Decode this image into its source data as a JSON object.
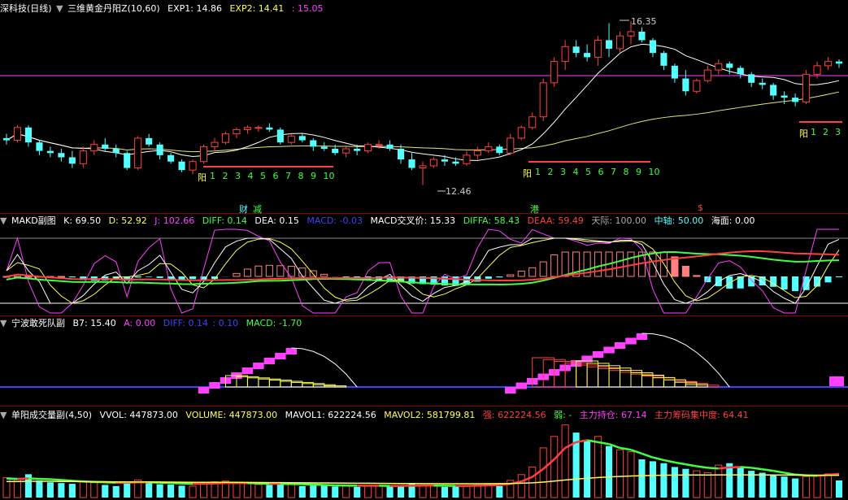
{
  "colors": {
    "red": "#ff4040",
    "cyan": "#54ffff",
    "yellow": "#ffff55",
    "white": "#ffffff",
    "magenta": "#ff40ff",
    "green": "#40ff40",
    "blue": "#4040ff",
    "pink": "#ff8080",
    "orange": "#ffbb33"
  },
  "panel1": {
    "stock": "深科技(日线)",
    "indicator": "三维黄金丹阳Z(10,60)",
    "exp1": "EXP1: 14.86",
    "exp2": "EXP2: 14.41",
    "exp3": ": 15.05",
    "high_label": "16.35",
    "low_label": "12.46",
    "yang": "阳",
    "count_labels": [
      "1",
      "2",
      "3",
      "4",
      "5",
      "6",
      "7",
      "8",
      "9",
      "10"
    ],
    "count_labels_short": [
      "1",
      "2",
      "3"
    ],
    "marker_cai": "财",
    "marker_jian": "减",
    "marker_gang": "港",
    "marker_dollar": "$"
  },
  "panel2": {
    "name": "MAKD副图",
    "k": "K: 69.50",
    "d": "D: 52.92",
    "j": "J: 102.66",
    "diff": "DIFF: 0.14",
    "dea": "DEA: 0.15",
    "macd": "MACD: -0.03",
    "cross_price": "MACD交叉价: 15.33",
    "diffa": "DIFFA: 58.43",
    "deaa": "DEAA: 59.49",
    "tianji": "天际: 100.00",
    "zhongzhou": "中轴: 50.00",
    "haimian": "海面: 0.00"
  },
  "panel3": {
    "name": "宁波敢死队副",
    "b7": "B7: 15.40",
    "a": "A: 0.00",
    "diff": "DIFF: 0.14",
    "val": ": 0.10",
    "macd": "MACD: -1.70"
  },
  "panel4": {
    "name": "单阳成交量副(4,50)",
    "vvol": "VVOL: 447873.00",
    "volume": "VOLUME: 447873.00",
    "mavol1": "MAVOL1: 622224.56",
    "mavol2": "MAVOL2: 581799.81",
    "qiang": "强: 622224.56",
    "ruo": "弱: -",
    "zhuli": "主力持仓: 67.14",
    "jizhong": "主力筹码集中度: 64.41"
  },
  "chart_data": {
    "type": "candlestick",
    "price_high": 16.35,
    "price_low": 12.46,
    "candles": [
      [
        13.6,
        13.7,
        13.45,
        13.55
      ],
      [
        13.55,
        13.9,
        13.5,
        13.85
      ],
      [
        13.85,
        13.9,
        13.4,
        13.5
      ],
      [
        13.5,
        13.55,
        13.2,
        13.3
      ],
      [
        13.3,
        13.4,
        13.15,
        13.25
      ],
      [
        13.25,
        13.35,
        13.05,
        13.15
      ],
      [
        13.15,
        13.3,
        12.9,
        13.0
      ],
      [
        13.0,
        13.4,
        12.9,
        13.3
      ],
      [
        13.3,
        13.55,
        13.2,
        13.45
      ],
      [
        13.45,
        13.6,
        13.3,
        13.35
      ],
      [
        13.35,
        13.45,
        13.15,
        13.25
      ],
      [
        13.25,
        13.3,
        12.85,
        12.9
      ],
      [
        12.9,
        13.65,
        12.85,
        13.6
      ],
      [
        13.6,
        13.7,
        13.4,
        13.45
      ],
      [
        13.45,
        13.5,
        13.1,
        13.2
      ],
      [
        13.2,
        13.25,
        13.0,
        13.05
      ],
      [
        13.05,
        13.1,
        12.8,
        12.85
      ],
      [
        12.85,
        13.1,
        12.75,
        13.05
      ],
      [
        13.05,
        13.45,
        13.0,
        13.4
      ],
      [
        13.4,
        13.6,
        13.3,
        13.5
      ],
      [
        13.5,
        13.75,
        13.45,
        13.7
      ],
      [
        13.7,
        13.85,
        13.6,
        13.8
      ],
      [
        13.8,
        13.9,
        13.7,
        13.85
      ],
      [
        13.85,
        13.9,
        13.75,
        13.85
      ],
      [
        13.85,
        13.95,
        13.75,
        13.8
      ],
      [
        13.8,
        13.85,
        13.45,
        13.5
      ],
      [
        13.5,
        13.7,
        13.45,
        13.65
      ],
      [
        13.65,
        13.7,
        13.5,
        13.55
      ],
      [
        13.55,
        13.6,
        13.3,
        13.4
      ],
      [
        13.4,
        13.5,
        13.3,
        13.35
      ],
      [
        13.35,
        13.45,
        13.2,
        13.25
      ],
      [
        13.25,
        13.4,
        13.15,
        13.35
      ],
      [
        13.35,
        13.45,
        13.2,
        13.3
      ],
      [
        13.3,
        13.5,
        13.25,
        13.45
      ],
      [
        13.45,
        13.55,
        13.35,
        13.45
      ],
      [
        13.45,
        13.55,
        13.3,
        13.35
      ],
      [
        13.35,
        13.45,
        13.0,
        13.1
      ],
      [
        13.1,
        13.25,
        12.85,
        12.9
      ],
      [
        12.9,
        13.05,
        12.5,
        12.95
      ],
      [
        12.95,
        13.15,
        12.9,
        13.1
      ],
      [
        13.1,
        13.2,
        12.95,
        13.05
      ],
      [
        13.05,
        13.15,
        12.95,
        13.0
      ],
      [
        13.0,
        13.3,
        12.95,
        13.2
      ],
      [
        13.2,
        13.4,
        13.1,
        13.3
      ],
      [
        13.3,
        13.5,
        13.25,
        13.4
      ],
      [
        13.4,
        13.45,
        13.2,
        13.25
      ],
      [
        13.25,
        13.7,
        13.2,
        13.6
      ],
      [
        13.6,
        13.9,
        13.55,
        13.85
      ],
      [
        13.85,
        14.2,
        13.8,
        14.1
      ],
      [
        14.1,
        15.0,
        14.0,
        14.9
      ],
      [
        14.9,
        15.5,
        14.8,
        15.4
      ],
      [
        15.4,
        15.9,
        15.2,
        15.75
      ],
      [
        15.75,
        15.9,
        15.5,
        15.6
      ],
      [
        15.6,
        15.8,
        15.4,
        15.5
      ],
      [
        15.5,
        16.0,
        15.3,
        15.9
      ],
      [
        15.9,
        16.3,
        15.5,
        15.7
      ],
      [
        15.7,
        16.1,
        15.6,
        16.0
      ],
      [
        16.0,
        16.35,
        15.8,
        16.1
      ],
      [
        16.1,
        16.2,
        15.85,
        15.9
      ],
      [
        15.9,
        15.95,
        15.5,
        15.6
      ],
      [
        15.6,
        15.65,
        15.2,
        15.3
      ],
      [
        15.3,
        15.35,
        14.9,
        15.0
      ],
      [
        15.0,
        15.2,
        14.6,
        14.7
      ],
      [
        14.7,
        15.0,
        14.65,
        14.95
      ],
      [
        14.95,
        15.3,
        14.9,
        15.2
      ],
      [
        15.2,
        15.45,
        15.1,
        15.35
      ],
      [
        15.35,
        15.4,
        15.1,
        15.25
      ],
      [
        15.25,
        15.3,
        15.0,
        15.1
      ],
      [
        15.1,
        15.15,
        14.8,
        14.9
      ],
      [
        14.9,
        15.0,
        14.75,
        14.85
      ],
      [
        14.85,
        14.9,
        14.5,
        14.6
      ],
      [
        14.6,
        14.7,
        14.4,
        14.55
      ],
      [
        14.55,
        14.65,
        14.35,
        14.45
      ],
      [
        14.45,
        15.2,
        14.4,
        15.1
      ],
      [
        15.1,
        15.4,
        15.0,
        15.3
      ],
      [
        15.3,
        15.5,
        15.2,
        15.4
      ],
      [
        15.4,
        15.45,
        15.25,
        15.35
      ]
    ],
    "volume": [
      520000,
      470000,
      610000,
      450000,
      400000,
      380000,
      360000,
      420000,
      390000,
      330000,
      300000,
      420000,
      460000,
      400000,
      350000,
      340000,
      310000,
      300000,
      360000,
      410000,
      430000,
      380000,
      360000,
      340000,
      330000,
      380000,
      350000,
      300000,
      320000,
      310000,
      290000,
      300000,
      280000,
      320000,
      300000,
      290000,
      310000,
      350000,
      330000,
      300000,
      280000,
      290000,
      310000,
      330000,
      340000,
      300000,
      450000,
      600000,
      800000,
      1300000,
      1600000,
      1900000,
      1700000,
      1500000,
      1600000,
      1350000,
      1250000,
      1200000,
      1000000,
      950000,
      900000,
      800000,
      750000,
      700000,
      650000,
      850000,
      900000,
      800000,
      700000,
      650000,
      600000,
      550000,
      500000,
      550000,
      580000,
      620000,
      447873
    ],
    "mavol1": [
      500000,
      490000,
      500000,
      490000,
      480000,
      460000,
      440000,
      420000,
      410000,
      400000,
      390000,
      390000,
      400000,
      400000,
      390000,
      380000,
      370000,
      360000,
      360000,
      370000,
      380000,
      380000,
      380000,
      370000,
      360000,
      360000,
      355000,
      350000,
      340000,
      330000,
      320000,
      315000,
      310000,
      310000,
      310000,
      305000,
      305000,
      310000,
      315000,
      315000,
      310000,
      305000,
      305000,
      310000,
      320000,
      330000,
      360000,
      420000,
      540000,
      750000,
      1000000,
      1300000,
      1450000,
      1500000,
      1450000,
      1400000,
      1300000,
      1250000,
      1150000,
      1050000,
      980000,
      920000,
      870000,
      820000,
      780000,
      760000,
      790000,
      800000,
      780000,
      740000,
      700000,
      650000,
      600000,
      580000,
      570000,
      590000,
      622224
    ],
    "mavol2": [
      420000,
      420000,
      425000,
      425000,
      425000,
      420000,
      420000,
      418000,
      416000,
      414000,
      410000,
      410000,
      410000,
      410000,
      408000,
      405000,
      402000,
      400000,
      400000,
      400000,
      400000,
      398000,
      396000,
      394000,
      392000,
      390000,
      388000,
      386000,
      384000,
      382000,
      380000,
      378000,
      376000,
      374000,
      372000,
      370000,
      368000,
      366000,
      365000,
      364000,
      363000,
      362000,
      362000,
      362000,
      363000,
      364000,
      368000,
      374000,
      385000,
      405000,
      430000,
      460000,
      485000,
      505000,
      525000,
      540000,
      552000,
      563000,
      572000,
      580000,
      585000,
      588000,
      590000,
      591000,
      591000,
      592000,
      593000,
      593000,
      593000,
      592000,
      591000,
      590000,
      588000,
      586000,
      584000,
      583000,
      581799
    ]
  }
}
